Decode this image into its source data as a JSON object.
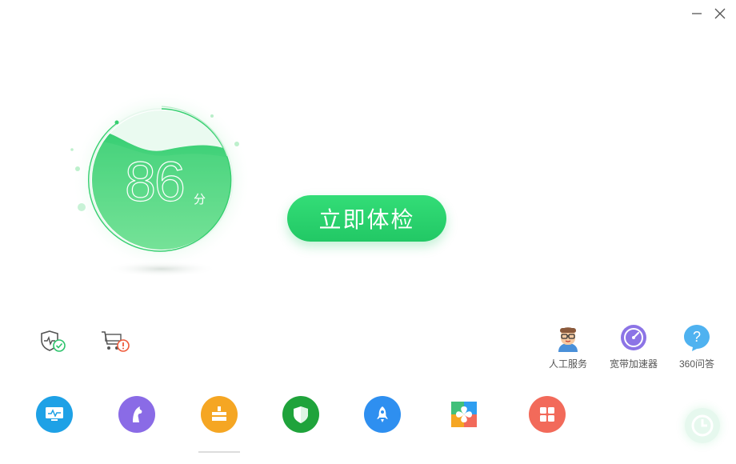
{
  "window": {
    "minimize_label": "—",
    "close_label": "✕"
  },
  "score": {
    "value": "86",
    "unit": "分",
    "level": 0.86
  },
  "check_button": {
    "label": "立即体检"
  },
  "status_icons": [
    {
      "name": "shield-check-icon",
      "state": "ok"
    },
    {
      "name": "cart-warning-icon",
      "state": "warning"
    }
  ],
  "tools": [
    {
      "icon": "customer-service-icon",
      "label": "人工服务"
    },
    {
      "icon": "speedometer-icon",
      "label": "宽带加速器"
    },
    {
      "icon": "question-icon",
      "label": "360问答"
    }
  ],
  "nav": [
    {
      "icon": "monitor-icon",
      "color": "#1ea1e6"
    },
    {
      "icon": "horse-icon",
      "color": "#8a6be6"
    },
    {
      "icon": "broom-icon",
      "color": "#f5a623",
      "active": true
    },
    {
      "icon": "shield-icon",
      "color": "#1fa33b"
    },
    {
      "icon": "rocket-icon",
      "color": "#2e8ff0"
    },
    {
      "icon": "flower-icon",
      "color": "#41c07a"
    },
    {
      "icon": "grid-icon",
      "color": "#f26a5a"
    }
  ],
  "colors": {
    "accent": "#22c865",
    "score_gradient_top": "#3ad276",
    "score_gradient_bottom": "#8ae9a3"
  }
}
